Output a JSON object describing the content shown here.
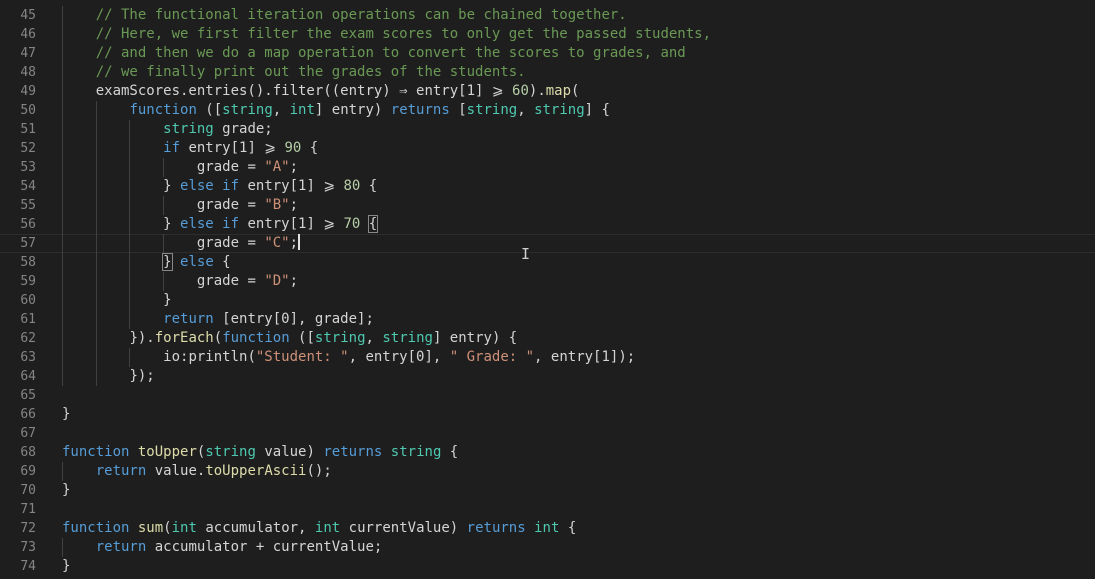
{
  "lines": [
    {
      "n": "45",
      "indent": 1,
      "tokens": [
        [
          "c",
          "// The functional iteration operations can be chained together."
        ]
      ]
    },
    {
      "n": "46",
      "indent": 1,
      "tokens": [
        [
          "c",
          "// Here, we first filter the exam scores to only get the passed students,"
        ]
      ]
    },
    {
      "n": "47",
      "indent": 1,
      "tokens": [
        [
          "c",
          "// and then we do a map operation to convert the scores to grades, and"
        ]
      ]
    },
    {
      "n": "48",
      "indent": 1,
      "tokens": [
        [
          "c",
          "// we finally print out the grades of the students."
        ]
      ]
    },
    {
      "n": "49",
      "indent": 1,
      "tokens": [
        [
          "p",
          "examScores.entries().filter((entry) ⇒ entry[1] ⩾ "
        ],
        [
          "n",
          "60"
        ],
        [
          "p",
          ")."
        ],
        [
          "f",
          "map"
        ],
        [
          "p",
          "("
        ]
      ]
    },
    {
      "n": "50",
      "indent": 2,
      "tokens": [
        [
          "k",
          "function"
        ],
        [
          "p",
          " (["
        ],
        [
          "t",
          "string"
        ],
        [
          "p",
          ", "
        ],
        [
          "t",
          "int"
        ],
        [
          "p",
          "] entry) "
        ],
        [
          "k",
          "returns"
        ],
        [
          "p",
          " ["
        ],
        [
          "t",
          "string"
        ],
        [
          "p",
          ", "
        ],
        [
          "t",
          "string"
        ],
        [
          "p",
          "] {"
        ]
      ]
    },
    {
      "n": "51",
      "indent": 3,
      "tokens": [
        [
          "t",
          "string"
        ],
        [
          "p",
          " grade;"
        ]
      ]
    },
    {
      "n": "52",
      "indent": 3,
      "tokens": [
        [
          "k",
          "if"
        ],
        [
          "p",
          " entry[1] ⩾ "
        ],
        [
          "n",
          "90"
        ],
        [
          "p",
          " {"
        ]
      ]
    },
    {
      "n": "53",
      "indent": 4,
      "tokens": [
        [
          "p",
          "grade = "
        ],
        [
          "s",
          "\"A\""
        ],
        [
          "p",
          ";"
        ]
      ]
    },
    {
      "n": "54",
      "indent": 3,
      "tokens": [
        [
          "p",
          "} "
        ],
        [
          "k",
          "else if"
        ],
        [
          "p",
          " entry[1] ⩾ "
        ],
        [
          "n",
          "80"
        ],
        [
          "p",
          " {"
        ]
      ]
    },
    {
      "n": "55",
      "indent": 4,
      "tokens": [
        [
          "p",
          "grade = "
        ],
        [
          "s",
          "\"B\""
        ],
        [
          "p",
          ";"
        ]
      ]
    },
    {
      "n": "56",
      "indent": 3,
      "tokens": [
        [
          "p",
          "} "
        ],
        [
          "k",
          "else if"
        ],
        [
          "p",
          " entry[1] ⩾ "
        ],
        [
          "n",
          "70"
        ],
        [
          "p",
          " "
        ],
        [
          "bm",
          "{"
        ]
      ]
    },
    {
      "n": "57",
      "indent": 4,
      "current": true,
      "tokens": [
        [
          "p",
          "grade = "
        ],
        [
          "s",
          "\"C\""
        ],
        [
          "p",
          ";"
        ],
        [
          "caret",
          ""
        ]
      ]
    },
    {
      "n": "58",
      "indent": 3,
      "tokens": [
        [
          "bm",
          "}"
        ],
        [
          "p",
          " "
        ],
        [
          "k",
          "else"
        ],
        [
          "p",
          " {"
        ]
      ]
    },
    {
      "n": "59",
      "indent": 4,
      "tokens": [
        [
          "p",
          "grade = "
        ],
        [
          "s",
          "\"D\""
        ],
        [
          "p",
          ";"
        ]
      ]
    },
    {
      "n": "60",
      "indent": 3,
      "tokens": [
        [
          "p",
          "}"
        ]
      ]
    },
    {
      "n": "61",
      "indent": 3,
      "tokens": [
        [
          "k",
          "return"
        ],
        [
          "p",
          " [entry[0], grade];"
        ]
      ]
    },
    {
      "n": "62",
      "indent": 2,
      "tokens": [
        [
          "p",
          "})."
        ],
        [
          "f",
          "forEach"
        ],
        [
          "p",
          "("
        ],
        [
          "k",
          "function"
        ],
        [
          "p",
          " (["
        ],
        [
          "t",
          "string"
        ],
        [
          "p",
          ", "
        ],
        [
          "t",
          "string"
        ],
        [
          "p",
          "] entry) {"
        ]
      ]
    },
    {
      "n": "63",
      "indent": 3,
      "tokens": [
        [
          "p",
          "io:println("
        ],
        [
          "s",
          "\"Student: \""
        ],
        [
          "p",
          ", entry[0], "
        ],
        [
          "s",
          "\" Grade: \""
        ],
        [
          "p",
          ", entry[1]);"
        ]
      ]
    },
    {
      "n": "64",
      "indent": 2,
      "tokens": [
        [
          "p",
          "});"
        ]
      ]
    },
    {
      "n": "65",
      "indent": 0,
      "tokens": []
    },
    {
      "n": "66",
      "indent": 0,
      "tokens": [
        [
          "p",
          "}"
        ]
      ]
    },
    {
      "n": "67",
      "indent": 0,
      "tokens": []
    },
    {
      "n": "68",
      "indent": 0,
      "tokens": [
        [
          "k",
          "function"
        ],
        [
          "p",
          " "
        ],
        [
          "f",
          "toUpper"
        ],
        [
          "p",
          "("
        ],
        [
          "t",
          "string"
        ],
        [
          "p",
          " value) "
        ],
        [
          "k",
          "returns"
        ],
        [
          "p",
          " "
        ],
        [
          "t",
          "string"
        ],
        [
          "p",
          " {"
        ]
      ]
    },
    {
      "n": "69",
      "indent": 1,
      "tokens": [
        [
          "k",
          "return"
        ],
        [
          "p",
          " value."
        ],
        [
          "f",
          "toUpperAscii"
        ],
        [
          "p",
          "();"
        ]
      ]
    },
    {
      "n": "70",
      "indent": 0,
      "tokens": [
        [
          "p",
          "}"
        ]
      ]
    },
    {
      "n": "71",
      "indent": 0,
      "tokens": []
    },
    {
      "n": "72",
      "indent": 0,
      "tokens": [
        [
          "k",
          "function"
        ],
        [
          "p",
          " "
        ],
        [
          "f",
          "sum"
        ],
        [
          "p",
          "("
        ],
        [
          "t",
          "int"
        ],
        [
          "p",
          " accumulator, "
        ],
        [
          "t",
          "int"
        ],
        [
          "p",
          " currentValue) "
        ],
        [
          "k",
          "returns"
        ],
        [
          "p",
          " "
        ],
        [
          "t",
          "int"
        ],
        [
          "p",
          " {"
        ]
      ]
    },
    {
      "n": "73",
      "indent": 1,
      "tokens": [
        [
          "k",
          "return"
        ],
        [
          "p",
          " accumulator + currentValue;"
        ]
      ]
    },
    {
      "n": "74",
      "indent": 0,
      "tokens": [
        [
          "p",
          "}"
        ]
      ]
    }
  ],
  "colors": {
    "background": "#1e1e1e",
    "comment": "#6a9955",
    "keyword": "#569cd6",
    "type": "#4ec9b0",
    "function": "#dcdcaa",
    "string": "#ce9178",
    "number": "#b5cea8",
    "line_number": "#858585"
  },
  "icons": {
    "mouse_cursor": "i-beam-cursor-icon"
  }
}
